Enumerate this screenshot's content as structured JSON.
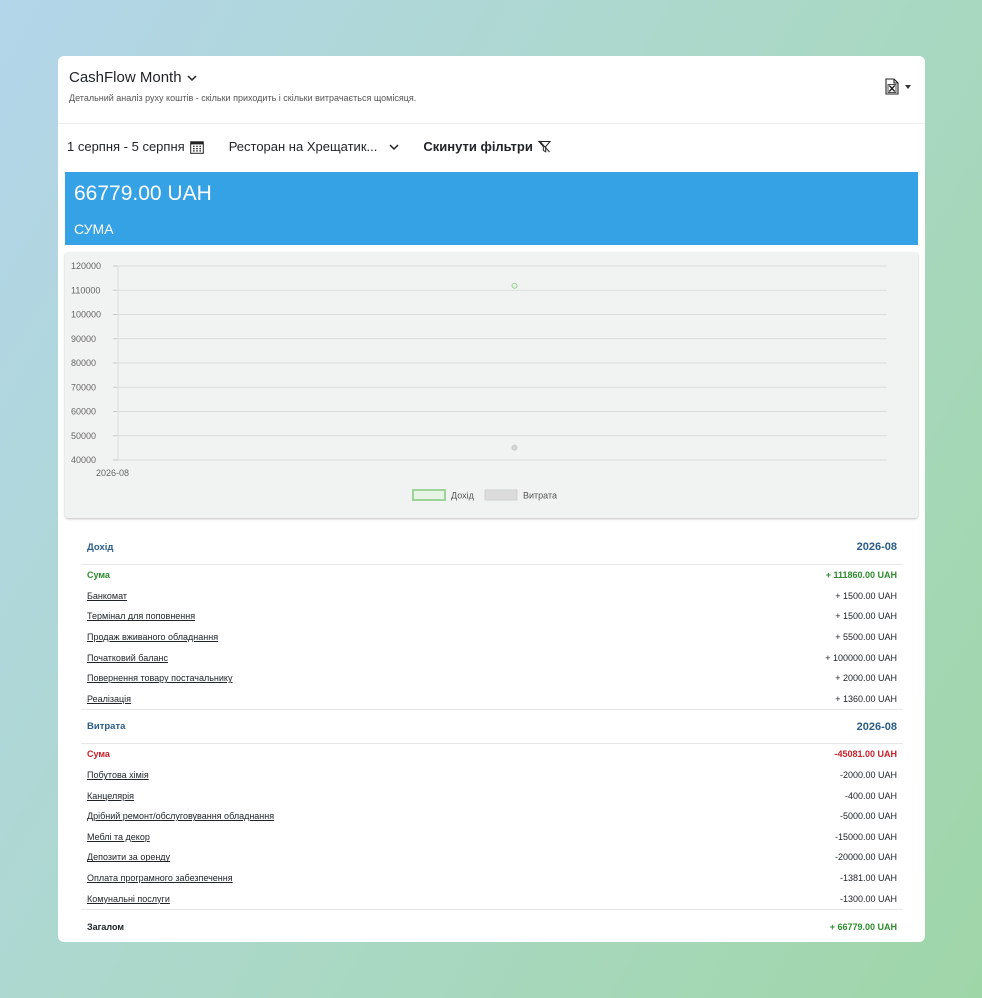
{
  "header": {
    "title": "CashFlow Month",
    "subtitle": "Детальний аналіз руху коштів - скільки приходить і скільки витрачається щомісяця."
  },
  "filters": {
    "date_range": "1 серпня - 5 серпня",
    "restaurant": "Ресторан на Хрещатик...",
    "reset": "Скинути фільтри"
  },
  "summary": {
    "amount": "66779.00 UAH",
    "label": "СУМА"
  },
  "colors": {
    "accent": "#35a2e6",
    "income": "#2e8b2e",
    "expense": "#c8202a",
    "section": "#2a5d8a"
  },
  "chart_data": {
    "type": "line",
    "x": [
      "2026-08"
    ],
    "series": [
      {
        "name": "Дохід",
        "values": [
          111860
        ]
      },
      {
        "name": "Витрата",
        "values": [
          45081
        ]
      }
    ],
    "ylim": [
      40000,
      120000
    ],
    "yticks": [
      "120000",
      "110000",
      "100000",
      "90000",
      "80000",
      "70000",
      "60000",
      "50000",
      "40000"
    ],
    "grid": true,
    "legend": "bottom-center"
  },
  "income": {
    "title": "Дохід",
    "period": "2026-08",
    "sum_label": "Сума",
    "sum_value": "+ 111860.00 UAH",
    "items": [
      {
        "name": "Банкомат",
        "value": "+ 1500.00 UAH"
      },
      {
        "name": "Термінал для поповнення",
        "value": "+ 1500.00 UAH"
      },
      {
        "name": "Продаж вживаного обладнання",
        "value": "+ 5500.00 UAH"
      },
      {
        "name": "Початковий баланс",
        "value": "+ 100000.00 UAH"
      },
      {
        "name": "Повернення товару постачальнику",
        "value": "+ 2000.00 UAH"
      },
      {
        "name": "Реалізація",
        "value": "+ 1360.00 UAH"
      }
    ]
  },
  "expense": {
    "title": "Витрата",
    "period": "2026-08",
    "sum_label": "Сума",
    "sum_value": "-45081.00 UAH",
    "items": [
      {
        "name": "Побутова хімія",
        "value": "-2000.00 UAH"
      },
      {
        "name": "Канцелярія",
        "value": "-400.00 UAH"
      },
      {
        "name": "Дрібний ремонт/обслуговування обладнання",
        "value": "-5000.00 UAH"
      },
      {
        "name": "Меблі та декор",
        "value": "-15000.00 UAH"
      },
      {
        "name": "Депозити за оренду",
        "value": "-20000.00 UAH"
      },
      {
        "name": "Оплата програмного забезпечення",
        "value": "-1381.00 UAH"
      },
      {
        "name": "Комунальні послуги",
        "value": "-1300.00 UAH"
      }
    ]
  },
  "total": {
    "label": "Загалом",
    "value": "+ 66779.00 UAH"
  }
}
